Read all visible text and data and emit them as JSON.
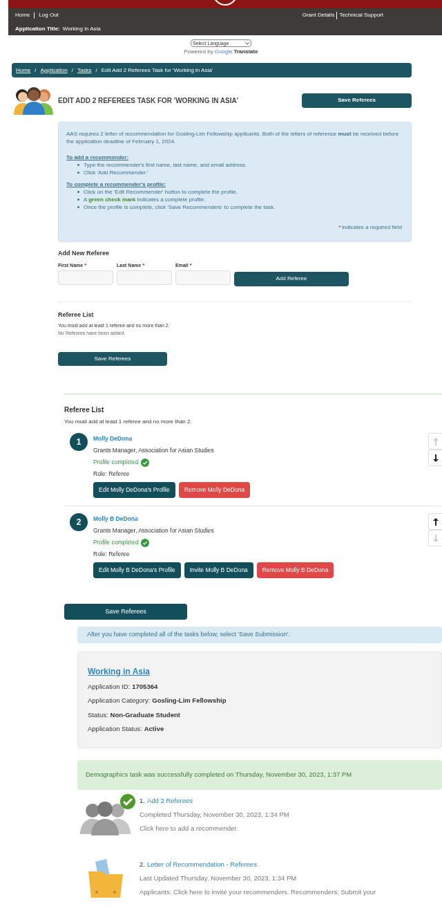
{
  "header": {
    "nav_left": [
      "Home",
      "Log Out"
    ],
    "nav_right": [
      "Grant Details",
      "Technical Support"
    ],
    "app_title_label": "Application Title:",
    "app_title_value": "Working in Asia"
  },
  "language": {
    "select": "Select Language",
    "powered_by": "Powered by",
    "google": "Google",
    "translate": "Translate"
  },
  "breadcrumb": {
    "links": [
      "Home",
      "Application",
      "Tasks"
    ],
    "separator": "/",
    "current": "Edit Add 2 Referees Task for 'Working in Asia'"
  },
  "page_title": "EDIT ADD 2 REFEREES TASK FOR 'WORKING IN ASIA'",
  "save_top": "Save Referees",
  "info": {
    "intro": "AAS requires 2 letter of recommendation for Gosling-Lim Fellowship applicants. Both of the letters of reference **must** be received before the application deadline of February 1, 2024.",
    "sections": [
      {
        "heading": "To add a recommender:",
        "bullets": [
          "Type the recommender's first name, last name, and email address.",
          "Click 'Add Recommender.'"
        ]
      },
      {
        "heading": "To complete a recommender's profile:",
        "bullets": [
          "Click on the 'Edit Recommender' button to complete the profile.",
          "A **green check mark** indicates a complete profile.",
          "Once the profile is complete, click 'Save Recommenders' to complete the task."
        ]
      }
    ],
    "required_star": "*",
    "required_note": "indicates a required field"
  },
  "add_form": {
    "heading": "Add New Referee",
    "fields": [
      {
        "label": "First Name",
        "required": true
      },
      {
        "label": "Last Name",
        "required": true
      },
      {
        "label": "Email",
        "required": true
      }
    ],
    "button": "Add Referee"
  },
  "empty_list": {
    "heading": "Referee List",
    "rule": "You must add at least 1 referee and no more than 2.",
    "empty": "No Referees have been added.",
    "save": "Save Referees"
  },
  "referee_list": {
    "heading": "Referee List",
    "rule": "You must add at least 1 referee and no more than 2.",
    "save": "Save Referees",
    "referees": [
      {
        "number": "1",
        "name": "Molly DeDona",
        "title": "Grants Manager, Association for Asian Studies",
        "status": "Profile completed",
        "completed": true,
        "role": "Role: Referee",
        "up_enabled": false,
        "down_enabled": true,
        "actions": [
          {
            "label": "Edit Molly DeDona's Profile",
            "kind": "primary"
          },
          {
            "label": "Remove Molly DeDona",
            "kind": "danger"
          }
        ]
      },
      {
        "number": "2",
        "name": "Molly B DeDona",
        "title": "Grants Manager, Association for Asian Studies",
        "status": "Profile completed",
        "completed": true,
        "role": "Role: Referee",
        "up_enabled": true,
        "down_enabled": false,
        "actions": [
          {
            "label": "Edit Molly B DeDona's Profile",
            "kind": "primary"
          },
          {
            "label": "Invite Molly B DeDona",
            "kind": "primary"
          },
          {
            "label": "Remove Molly B DeDona",
            "kind": "danger"
          }
        ]
      }
    ]
  },
  "submission_note": "After you have completed all of the tasks below, select 'Save Submission'.",
  "application": {
    "title": "Working in Asia",
    "fields": [
      {
        "label": "Application ID:",
        "value": "1705364"
      },
      {
        "label": "Application Category:",
        "value": "Gosling-Lim Fellowship"
      },
      {
        "label": "Status:",
        "value": "Non-Graduate Student"
      },
      {
        "label": "Application Status:",
        "value": "Active"
      }
    ]
  },
  "alert": "Demographics task was successfully completed on Thursday, November 30, 2023, 1:37 PM",
  "tasks": [
    {
      "number": "1.",
      "title": "Add 2 Referees",
      "kind": "people",
      "completed": true,
      "date": "Completed Thursday, November 30, 2023, 1:34 PM",
      "hint": "Click here to add a recommender."
    },
    {
      "number": "2.",
      "title": "Letter of Recommendation - Referees",
      "kind": "folder",
      "date": "Last Updated Thursday, November 30, 2023, 1:34 PM",
      "hint": "Applicants: Click here to invite your recommenders. Recommenders: Submit your"
    }
  ]
}
